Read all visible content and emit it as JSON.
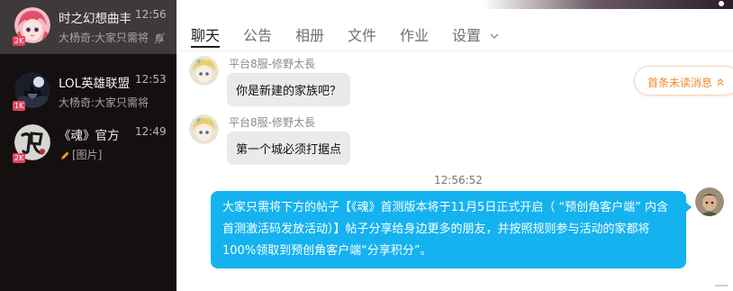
{
  "sidebar": {
    "conversations": [
      {
        "title": "时之幻想曲丰",
        "time": "12:56",
        "preview": "大杨奇:大家只需将",
        "badge": "2K",
        "muted": true,
        "selected": true,
        "avatar_icon": "anime-girl-avatar-icon"
      },
      {
        "title": "LOL英雄联盟",
        "time": "12:53",
        "preview": "大杨奇:大家只需将下方",
        "badge": "1K",
        "muted": false,
        "selected": false,
        "avatar_icon": "dark-figure-avatar-icon"
      },
      {
        "title": "《魂》官方",
        "time": "12:49",
        "preview": "[图片]",
        "badge": "2K",
        "muted": false,
        "selected": false,
        "avatar_icon": "hun-calligraphy-avatar-icon"
      }
    ]
  },
  "tabs": [
    {
      "label": "聊天",
      "active": true
    },
    {
      "label": "公告",
      "active": false
    },
    {
      "label": "相册",
      "active": false
    },
    {
      "label": "文件",
      "active": false
    },
    {
      "label": "作业",
      "active": false
    },
    {
      "label": "设置",
      "active": false,
      "has_dropdown": true
    }
  ],
  "messages": [
    {
      "sender": "平台8服-修野太長",
      "text": "你是新建的家族吧？",
      "direction": "incoming"
    },
    {
      "sender": "平台8服-修野太長",
      "text": "第一个城必须打据点",
      "direction": "incoming"
    }
  ],
  "timestamp": "12:56:52",
  "outgoing": {
    "lines": [
      "大家只需将下方的帖子【《魂》首测版本将于11月5日正式开启（ “预创角客户端” 内含",
      "首测激活码发放活动）】帖子分享给身边更多的朋友，并按照规则参与活动的家都将",
      "100%领取到预创角客户端“分享积分”。"
    ]
  },
  "unread": {
    "label": "首条未读消息",
    "chevron": "»"
  },
  "colors": {
    "sidebar_bg": "#141010",
    "selected_bg": "#3e3a3a",
    "outgoing_bubble": "#15b2f0",
    "incoming_bubble": "#eaeaea",
    "unread_accent": "#f08a2c",
    "badge": "#e0445d"
  }
}
